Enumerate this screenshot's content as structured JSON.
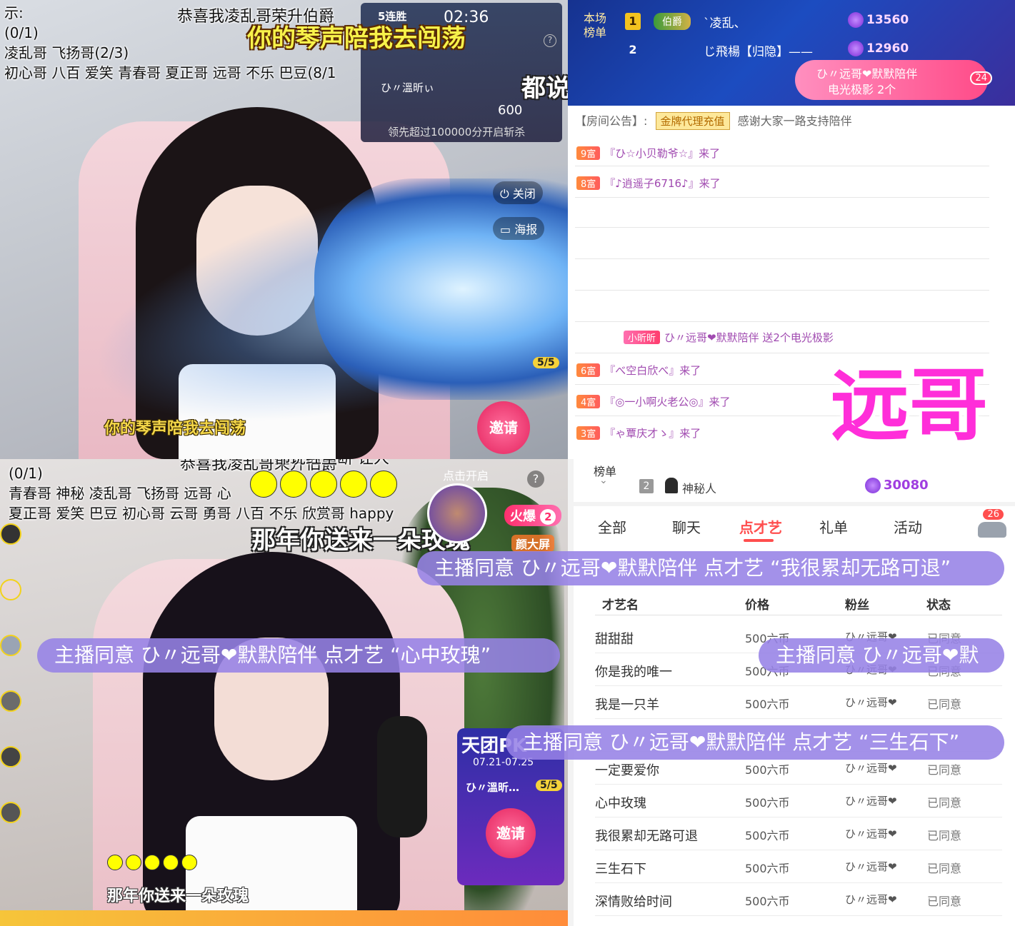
{
  "top_left": {
    "chat_lines": [
      "示:",
      "(0/1)",
      "凌乱哥 飞扬哥(2/3)",
      "初心哥 八百 爱笑 青春哥 夏正哥 远哥 不乐 巴豆(8/1"
    ],
    "congrats": "恭喜我凌乱哥荣升伯爵",
    "lyric_big": "你的琴声陪我去闯荡",
    "lyric_white": "都说红尘  让人断肠",
    "lyric_sub": "你的琴声陪我去闯荡",
    "pk": {
      "streak": "5连胜",
      "timer": "02:36",
      "help": "?",
      "user": "ひ〃溫昕ぃ",
      "score": "600",
      "note": "领先超过100000分开启斩杀"
    },
    "close_label": "关闭",
    "poster_label": "海报",
    "count": "5/5",
    "invite": "邀请"
  },
  "top_right": {
    "rank_label": [
      "本场",
      "榜单"
    ],
    "rank_rows": [
      {
        "rank": "1",
        "badge": "伯爵",
        "name": "`凌乱、",
        "coins": "13560"
      },
      {
        "rank": "2",
        "badge": "",
        "name": "じ飛楊【归隐】——",
        "coins": "12960"
      }
    ],
    "gift_banner": {
      "line1": "ひ〃远哥❤默默陪伴",
      "line2": "电光极影 2个",
      "count": "24"
    },
    "notice_label": "【房间公告】:",
    "notice_tag": "金牌代理充值",
    "notice_text": "感谢大家一路支持陪伴",
    "entries": [
      {
        "level": "9富",
        "text": "『ひ☆小贝勒爷☆』来了"
      },
      {
        "level": "8富",
        "text": "『♪逍遥子6716♪』来了"
      },
      {
        "level": "",
        "text": "ひ〃远哥❤默默陪伴 送2个电光极影"
      },
      {
        "level": "6富",
        "text": "『べ空白欣べ』来了"
      },
      {
        "level": "4富",
        "text": "『◎一小啊火老公◎』来了"
      },
      {
        "level": "3富",
        "text": "『ゃ覃庆才ゝ』来了"
      }
    ],
    "gift_tag": "小昕昕",
    "big_name": "远哥"
  },
  "bottom_left": {
    "congrats": "恭喜我凌乱哥荣升伯爵",
    "chat_lines": [
      "(0/1)",
      "青春哥 神秘 凌乱哥 飞扬哥 远哥 心",
      "夏正哥 爱笑 巴豆 初心哥 云哥 勇哥 八百 不乐 欣赏哥 happy"
    ],
    "lyric_white": "那年你送来一朵玫瑰",
    "lyric_sub": "那年你送来一朵玫瑰",
    "lyric_top": "都说红尘断  让人",
    "click_open": "点击开启",
    "hot_label": "火爆",
    "hot_count": "2",
    "big_screen": "颜大屏",
    "help": "?",
    "tuan": {
      "title": "天团PK",
      "dates": "07.21-07.25",
      "user": "ひ〃溫昕…",
      "count": "5/5",
      "invite": "邀请"
    }
  },
  "bottom_right": {
    "rank_label": "榜单",
    "rank_row": {
      "rank": "2",
      "name": "神秘人",
      "coins": "30080"
    },
    "tabs": [
      "全部",
      "聊天",
      "点才艺",
      "礼单",
      "活动"
    ],
    "active_tab": 2,
    "car_badge": "26",
    "columns": [
      "才艺名",
      "价格",
      "粉丝",
      "状态"
    ],
    "rows": [
      {
        "name": "甜甜甜",
        "price": "500六币",
        "fan": "ひ〃远哥❤",
        "status": "已同意"
      },
      {
        "name": "你是我的唯一",
        "price": "500六币",
        "fan": "ひ〃远哥❤",
        "status": "已同意"
      },
      {
        "name": "我是一只羊",
        "price": "500六币",
        "fan": "ひ〃远哥❤",
        "status": "已同意"
      },
      {
        "name": "",
        "price": "",
        "fan": "",
        "status": ""
      },
      {
        "name": "一定要爱你",
        "price": "500六币",
        "fan": "ひ〃远哥❤",
        "status": "已同意"
      },
      {
        "name": "心中玫瑰",
        "price": "500六币",
        "fan": "ひ〃远哥❤",
        "status": "已同意"
      },
      {
        "name": "我很累却无路可退",
        "price": "500六币",
        "fan": "ひ〃远哥❤",
        "status": "已同意"
      },
      {
        "name": "三生石下",
        "price": "500六币",
        "fan": "ひ〃远哥❤",
        "status": "已同意"
      },
      {
        "name": "深情败给时间",
        "price": "500六币",
        "fan": "ひ〃远哥❤",
        "status": "已同意"
      }
    ]
  },
  "toasts": [
    "主播同意 ひ〃远哥❤默默陪伴 点才艺 “我很累却无路可退”",
    "主播同意 ひ〃远哥❤默默陪伴 点才艺 “心中玫瑰”",
    "主播同意 ひ〃远哥❤默",
    "主播同意 ひ〃远哥❤默默陪伴 点才艺 “三生石下”"
  ]
}
